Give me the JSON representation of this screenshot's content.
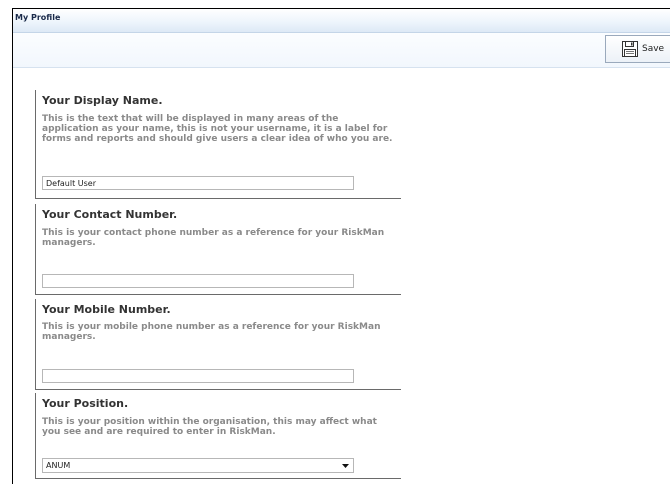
{
  "window": {
    "title": "My Profile"
  },
  "toolbar": {
    "save_label": "Save",
    "save_icon": "floppy-disk-icon"
  },
  "sections": {
    "display_name": {
      "title": "Your Display Name.",
      "description": "This is the text that will be displayed in many areas of the application as your name, this is not your username, it is a label for forms and reports and should give users a clear idea of who you are.",
      "value": "Default User"
    },
    "contact_number": {
      "title": "Your Contact Number.",
      "description": "This is your contact phone number as a reference for your RiskMan managers.",
      "value": ""
    },
    "mobile_number": {
      "title": "Your Mobile Number.",
      "description": "This is your mobile phone number as a reference for your RiskMan managers.",
      "value": ""
    },
    "position": {
      "title": "Your Position.",
      "description": "This is your position within the organisation, this may affect what you see and are required to enter in RiskMan.",
      "selected": "ANUM"
    }
  }
}
